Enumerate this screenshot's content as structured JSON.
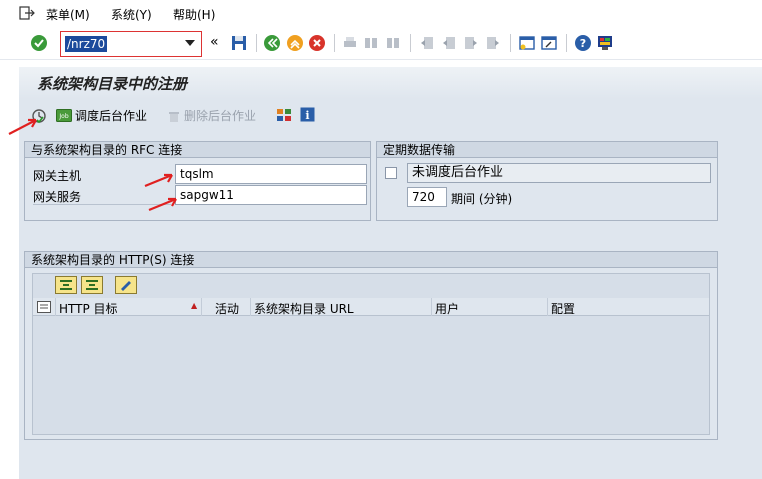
{
  "menu": {
    "items": [
      {
        "label": "菜单(M)"
      },
      {
        "label": "系统(Y)"
      },
      {
        "label": "帮助(H)"
      }
    ]
  },
  "toolbar": {
    "command_value": "/nrz70",
    "back_symbol": "«"
  },
  "page": {
    "title": "系统架构目录中的注册"
  },
  "app_toolbar": {
    "schedule_job_label": "调度后台作业",
    "delete_job_label": "删除后台作业"
  },
  "rfc_group": {
    "title": "与系统架构目录的 RFC 连接",
    "gateway_host_label": "网关主机",
    "gateway_host_value": "tqslm",
    "gateway_service_label": "网关服务",
    "gateway_service_value": "sapgw11"
  },
  "transfer_group": {
    "title": "定期数据传输",
    "status_value": "未调度后台作业",
    "period_value": "720",
    "period_label": "期间 (分钟)"
  },
  "http_group": {
    "title": "系统架构目录的 HTTP(S) 连接",
    "columns": [
      "HTTP 目标",
      "活动",
      "系统架构目录 URL",
      "用户",
      "配置"
    ]
  },
  "colors": {
    "accent_red": "#e02020",
    "selection_blue": "#1c4a9c",
    "page_bg": "#dfe6ee"
  }
}
